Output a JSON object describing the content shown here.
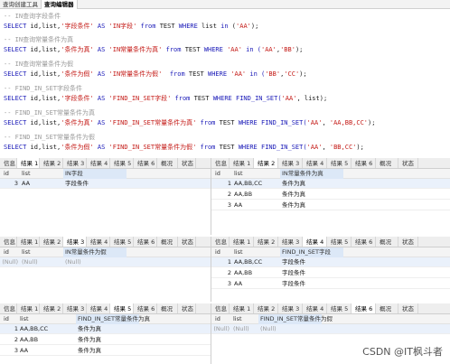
{
  "toolbar": {
    "tabs": [
      "查询创建工具",
      "查询编辑器"
    ]
  },
  "editor": {
    "lines": [
      {
        "parts": [
          {
            "t": "-- IN查询字段条件",
            "c": "cm"
          }
        ]
      },
      {
        "parts": [
          {
            "t": "SELECT",
            "c": "kw"
          },
          {
            "t": " id,list,",
            "c": "tx"
          },
          {
            "t": "'字段条件'",
            "c": "st"
          },
          {
            "t": " AS ",
            "c": "kw"
          },
          {
            "t": "'IN字段'",
            "c": "st"
          },
          {
            "t": " from ",
            "c": "kw"
          },
          {
            "t": "TEST ",
            "c": "tx"
          },
          {
            "t": "WHERE",
            "c": "kw"
          },
          {
            "t": " list ",
            "c": "tx"
          },
          {
            "t": "in",
            "c": "kw"
          },
          {
            "t": " (",
            "c": "tx"
          },
          {
            "t": "'AA'",
            "c": "st"
          },
          {
            "t": ");",
            "c": "tx"
          }
        ]
      },
      {
        "parts": [
          {
            "t": "-- IN查询常量条件为真",
            "c": "cm"
          }
        ]
      },
      {
        "parts": [
          {
            "t": "SELECT",
            "c": "kw"
          },
          {
            "t": " id,list,",
            "c": "tx"
          },
          {
            "t": "'条件为真'",
            "c": "st"
          },
          {
            "t": " AS ",
            "c": "kw"
          },
          {
            "t": "'IN常量条件为真'",
            "c": "st"
          },
          {
            "t": " from ",
            "c": "kw"
          },
          {
            "t": "TEST ",
            "c": "tx"
          },
          {
            "t": "WHERE",
            "c": "kw"
          },
          {
            "t": " ",
            "c": "tx"
          },
          {
            "t": "'AA'",
            "c": "st"
          },
          {
            "t": " in (",
            "c": "kw"
          },
          {
            "t": "'AA'",
            "c": "st"
          },
          {
            "t": ",",
            "c": "tx"
          },
          {
            "t": "'BB'",
            "c": "st"
          },
          {
            "t": ");",
            "c": "tx"
          }
        ]
      },
      {
        "parts": [
          {
            "t": "-- IN查询常量条件为假",
            "c": "cm"
          }
        ]
      },
      {
        "parts": [
          {
            "t": "SELECT",
            "c": "kw"
          },
          {
            "t": " id,list,",
            "c": "tx"
          },
          {
            "t": "'条件为假'",
            "c": "st"
          },
          {
            "t": " AS ",
            "c": "kw"
          },
          {
            "t": "'IN常量条件为假'",
            "c": "st"
          },
          {
            "t": "  from ",
            "c": "kw"
          },
          {
            "t": "TEST ",
            "c": "tx"
          },
          {
            "t": "WHERE",
            "c": "kw"
          },
          {
            "t": " ",
            "c": "tx"
          },
          {
            "t": "'AA'",
            "c": "st"
          },
          {
            "t": " in (",
            "c": "kw"
          },
          {
            "t": "'BB'",
            "c": "st"
          },
          {
            "t": ",",
            "c": "tx"
          },
          {
            "t": "'CC'",
            "c": "st"
          },
          {
            "t": ");",
            "c": "tx"
          }
        ]
      },
      {
        "parts": [
          {
            "t": "-- FIND_IN_SET字段条件",
            "c": "cm"
          }
        ]
      },
      {
        "parts": [
          {
            "t": "SELECT",
            "c": "kw"
          },
          {
            "t": " id,list,",
            "c": "tx"
          },
          {
            "t": "'字段条件'",
            "c": "st"
          },
          {
            "t": " AS ",
            "c": "kw"
          },
          {
            "t": "'FIND_IN_SET字段'",
            "c": "st"
          },
          {
            "t": " from ",
            "c": "kw"
          },
          {
            "t": "TEST ",
            "c": "tx"
          },
          {
            "t": "WHERE",
            "c": "kw"
          },
          {
            "t": " FIND_IN_SET(",
            "c": "fn"
          },
          {
            "t": "'AA'",
            "c": "st"
          },
          {
            "t": ", list);",
            "c": "tx"
          }
        ]
      },
      {
        "parts": [
          {
            "t": "-- FIND_IN_SET常量条件为真",
            "c": "cm"
          }
        ]
      },
      {
        "parts": [
          {
            "t": "SELECT",
            "c": "kw"
          },
          {
            "t": " id,list,",
            "c": "tx"
          },
          {
            "t": "'条件为真'",
            "c": "st"
          },
          {
            "t": " AS ",
            "c": "kw"
          },
          {
            "t": "'FIND_IN_SET常量条件为真'",
            "c": "st"
          },
          {
            "t": " from ",
            "c": "kw"
          },
          {
            "t": "TEST ",
            "c": "tx"
          },
          {
            "t": "WHERE",
            "c": "kw"
          },
          {
            "t": " FIND_IN_SET(",
            "c": "fn"
          },
          {
            "t": "'AA'",
            "c": "st"
          },
          {
            "t": ", ",
            "c": "tx"
          },
          {
            "t": "'AA,BB,CC'",
            "c": "st"
          },
          {
            "t": ");",
            "c": "tx"
          }
        ]
      },
      {
        "parts": [
          {
            "t": "-- FIND_IN_SET常量条件为假",
            "c": "cm"
          }
        ]
      },
      {
        "parts": [
          {
            "t": "SELECT",
            "c": "kw"
          },
          {
            "t": " id,list,",
            "c": "tx"
          },
          {
            "t": "'条件为假'",
            "c": "st"
          },
          {
            "t": " AS ",
            "c": "kw"
          },
          {
            "t": "'FIND_IN_SET常量条件为假'",
            "c": "st"
          },
          {
            "t": " from ",
            "c": "kw"
          },
          {
            "t": "TEST ",
            "c": "tx"
          },
          {
            "t": "WHERE",
            "c": "kw"
          },
          {
            "t": " FIND_IN_SET(",
            "c": "fn"
          },
          {
            "t": "'AA'",
            "c": "st"
          },
          {
            "t": ", ",
            "c": "tx"
          },
          {
            "t": "'BB,CC'",
            "c": "st"
          },
          {
            "t": ");",
            "c": "tx"
          }
        ]
      }
    ]
  },
  "results": [
    {
      "tabs": [
        "信息",
        "结果 1",
        "结果 2",
        "结果 3",
        "结果 4",
        "结果 5",
        "结果 6",
        "概况",
        "状态"
      ],
      "active": 1,
      "columns": [
        "id",
        "list",
        "IN字段"
      ],
      "rows": [
        [
          "3",
          "AA",
          "字段条件"
        ]
      ]
    },
    {
      "tabs": [
        "信息",
        "结果 1",
        "结果 2",
        "结果 3",
        "结果 4",
        "结果 5",
        "结果 6",
        "概况",
        "状态"
      ],
      "active": 2,
      "columns": [
        "id",
        "list",
        "IN常量条件为真"
      ],
      "rows": [
        [
          "1",
          "AA,BB,CC",
          "条件为真"
        ],
        [
          "2",
          "AA,BB",
          "条件为真"
        ],
        [
          "3",
          "AA",
          "条件为真"
        ]
      ]
    },
    {
      "tabs": [
        "信息",
        "结果 1",
        "结果 2",
        "结果 3",
        "结果 4",
        "结果 5",
        "结果 6",
        "概况",
        "状态"
      ],
      "active": 3,
      "columns": [
        "id",
        "list",
        "IN常量条件为假"
      ],
      "rows": [
        [
          "(Null)",
          "(Null)",
          "(Null)"
        ]
      ]
    },
    {
      "tabs": [
        "信息",
        "结果 1",
        "结果 2",
        "结果 3",
        "结果 4",
        "结果 5",
        "结果 6",
        "概况",
        "状态"
      ],
      "active": 4,
      "columns": [
        "id",
        "list",
        "FIND_IN_SET字段"
      ],
      "rows": [
        [
          "1",
          "AA,BB,CC",
          "字段条件"
        ],
        [
          "2",
          "AA,BB",
          "字段条件"
        ],
        [
          "3",
          "AA",
          "字段条件"
        ]
      ]
    },
    {
      "tabs": [
        "信息",
        "结果 1",
        "结果 2",
        "结果 3",
        "结果 4",
        "结果 5",
        "结果 6",
        "概况",
        "状态"
      ],
      "active": 5,
      "columns": [
        "id",
        "list",
        "FIND_IN_SET常量条件为真"
      ],
      "rows": [
        [
          "1",
          "AA,BB,CC",
          "条件为真"
        ],
        [
          "2",
          "AA,BB",
          "条件为真"
        ],
        [
          "3",
          "AA",
          "条件为真"
        ]
      ]
    },
    {
      "tabs": [
        "信息",
        "结果 1",
        "结果 2",
        "结果 3",
        "结果 4",
        "结果 5",
        "结果 6",
        "概况",
        "状态"
      ],
      "active": 6,
      "columns": [
        "id",
        "list",
        "FIND_IN_SET常量条件为假"
      ],
      "rows": [
        [
          "(Null)",
          "(Null)",
          "(Null)"
        ]
      ]
    }
  ],
  "watermark": "CSDN @IT枫斗者"
}
